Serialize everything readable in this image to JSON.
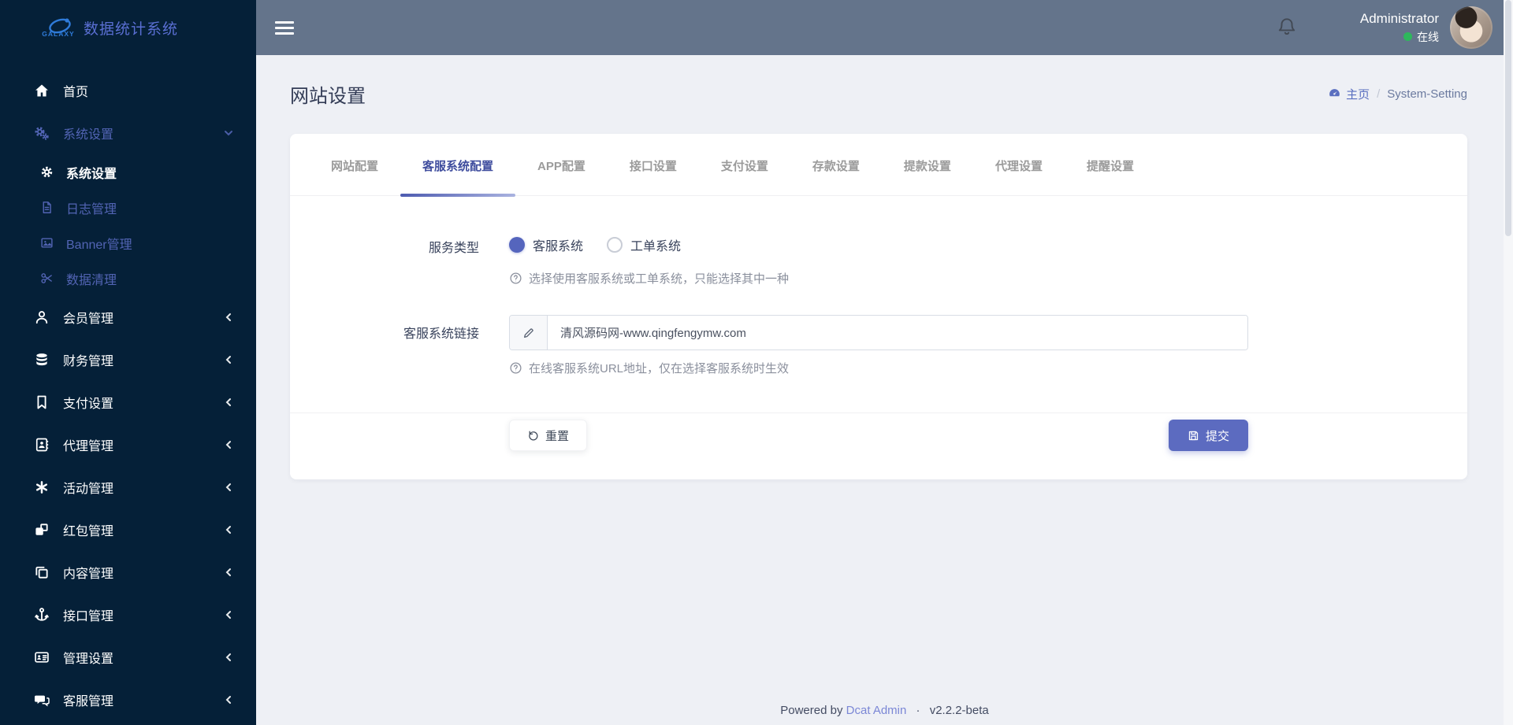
{
  "brand": {
    "logo": "GALAXY",
    "title": "数据统计系统"
  },
  "topbar": {
    "username": "Administrator",
    "status": "在线"
  },
  "sidebar": [
    {
      "label": "首页",
      "icon": "home-icon"
    },
    {
      "label": "系统设置",
      "icon": "cogs-icon",
      "expanded": true,
      "children": [
        {
          "label": "系统设置",
          "icon": "gear-icon",
          "active": true
        },
        {
          "label": "日志管理",
          "icon": "file-icon"
        },
        {
          "label": "Banner管理",
          "icon": "image-icon"
        },
        {
          "label": "数据清理",
          "icon": "scissors-icon"
        }
      ]
    },
    {
      "label": "会员管理",
      "icon": "user-icon"
    },
    {
      "label": "财务管理",
      "icon": "database-icon"
    },
    {
      "label": "支付设置",
      "icon": "bookmark-icon"
    },
    {
      "label": "代理管理",
      "icon": "address-book-icon"
    },
    {
      "label": "活动管理",
      "icon": "asterisk-icon"
    },
    {
      "label": "红包管理",
      "icon": "cubes-icon"
    },
    {
      "label": "内容管理",
      "icon": "copy-icon"
    },
    {
      "label": "接口管理",
      "icon": "anchor-icon"
    },
    {
      "label": "管理设置",
      "icon": "id-card-icon"
    },
    {
      "label": "客服管理",
      "icon": "comments-icon"
    }
  ],
  "page": {
    "title": "网站设置",
    "breadcrumb_home": "主页",
    "breadcrumb_sep": "/",
    "breadcrumb_current": "System-Setting"
  },
  "tabs": [
    {
      "label": "网站配置",
      "active": false
    },
    {
      "label": "客服系统配置",
      "active": true
    },
    {
      "label": "APP配置",
      "active": false
    },
    {
      "label": "接口设置",
      "active": false
    },
    {
      "label": "支付设置",
      "active": false
    },
    {
      "label": "存款设置",
      "active": false
    },
    {
      "label": "提款设置",
      "active": false
    },
    {
      "label": "代理设置",
      "active": false
    },
    {
      "label": "提醒设置",
      "active": false
    }
  ],
  "form": {
    "service_type": {
      "label": "服务类型",
      "options": [
        {
          "label": "客服系统",
          "selected": true
        },
        {
          "label": "工单系统",
          "selected": false
        }
      ],
      "help": "选择使用客服系统或工单系统，只能选择其中一种"
    },
    "service_link": {
      "label": "客服系统链接",
      "value": "清风源码网-www.qingfengymw.com",
      "help": "在线客服系统URL地址，仅在选择客服系统时生效"
    },
    "reset_label": "重置",
    "submit_label": "提交"
  },
  "footer": {
    "powered_by": "Powered by",
    "brand_link": "Dcat Admin",
    "dot": "·",
    "version": "v2.2.2-beta"
  },
  "colors": {
    "sidebar_bg": "#052038",
    "header_bg": "#64748b",
    "content_bg": "#eef0f5",
    "accent": "#5c6bc0",
    "sidebar_accent_text": "#5264b4",
    "active_tab": "#3f4d9e",
    "online_green": "#2eb85c"
  }
}
